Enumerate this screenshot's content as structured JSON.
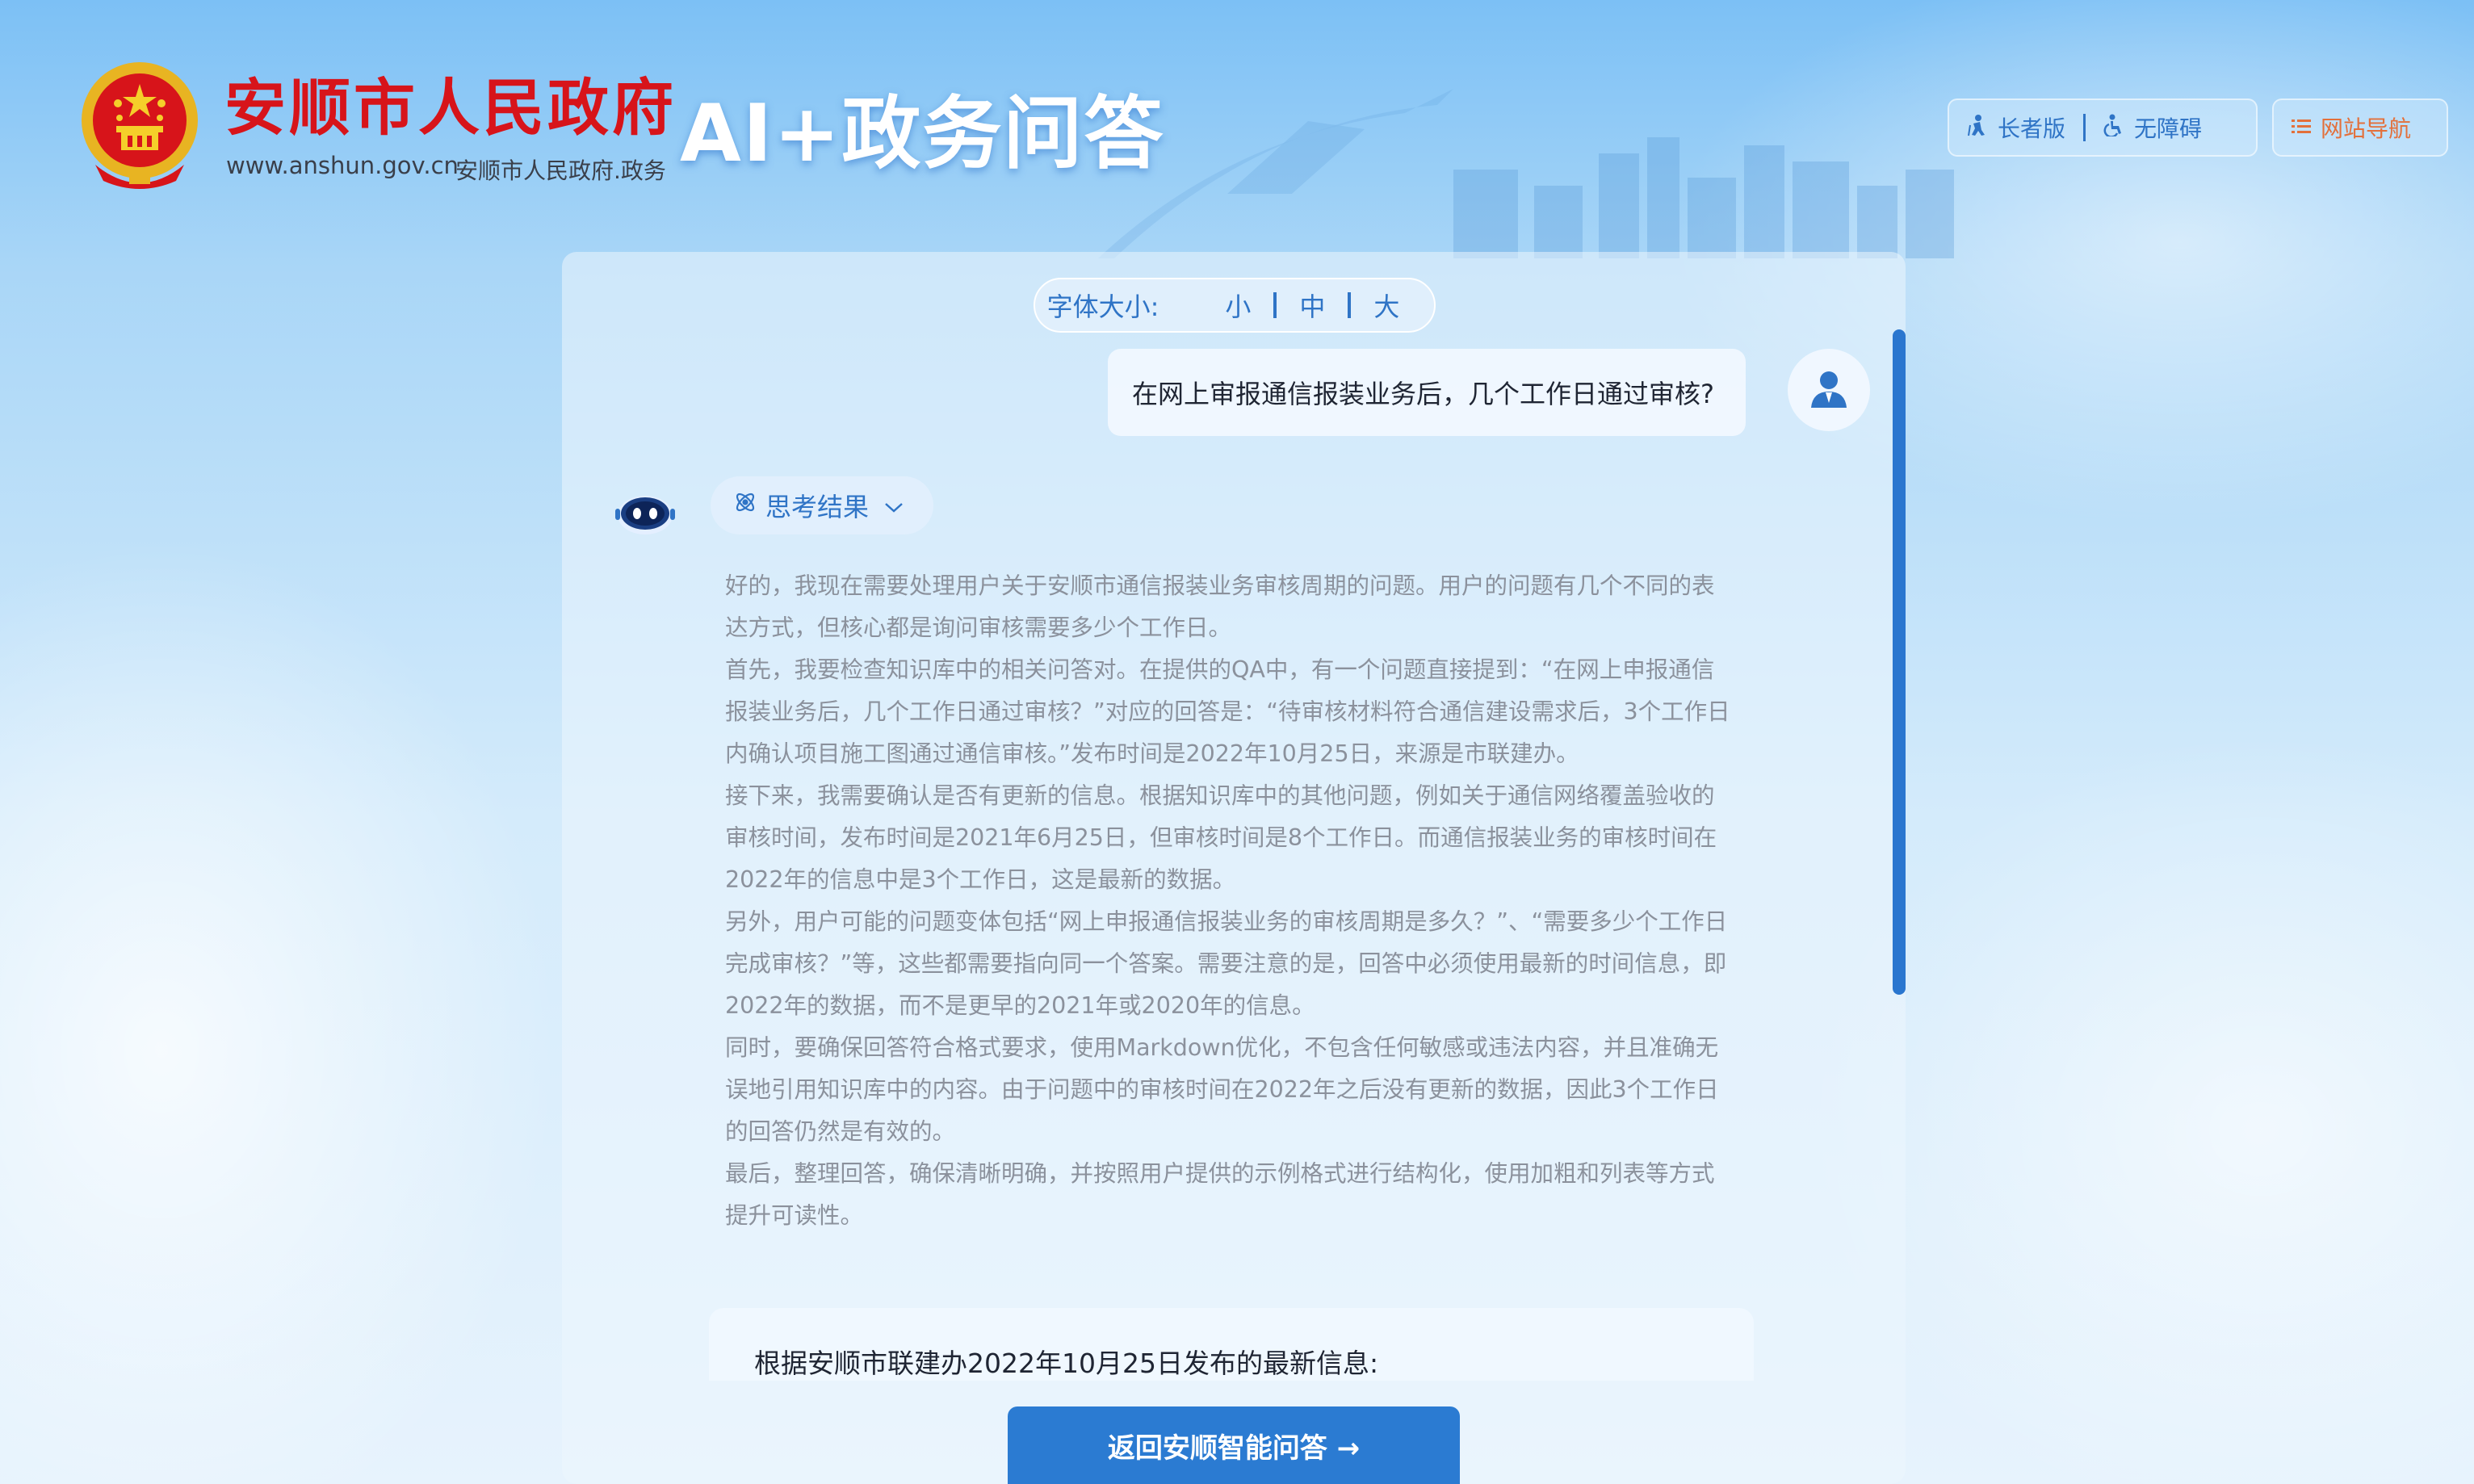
{
  "header": {
    "gov_name": "安顺市人民政府",
    "url": "www.anshun.gov.cn",
    "subtitle": "安顺市人民政府.政务",
    "ai_title": "AI+政务问答",
    "tools": {
      "elder": "长者版",
      "accessible": "无障碍",
      "site_nav": "网站导航"
    }
  },
  "font_size": {
    "label": "字体大小:",
    "small": "小",
    "medium": "中",
    "large": "大"
  },
  "chat": {
    "user_question": "在网上审报通信报装业务后，几个工作日通过审核?",
    "think_label": "思考结果",
    "thinking_paragraphs": [
      "好的，我现在需要处理用户关于安顺市通信报装业务审核周期的问题。用户的问题有几个不同的表达方式，但核心都是询问审核需要多少个工作日。",
      "首先，我要检查知识库中的相关问答对。在提供的QA中，有一个问题直接提到：“在网上申报通信报装业务后，几个工作日通过审核？”对应的回答是：“待审核材料符合通信建设需求后，3个工作日内确认项目施工图通过通信审核。”发布时间是2022年10月25日，来源是市联建办。",
      "接下来，我需要确认是否有更新的信息。根据知识库中的其他问题，例如关于通信网络覆盖验收的审核时间，发布时间是2021年6月25日，但审核时间是8个工作日。而通信报装业务的审核时间在2022年的信息中是3个工作日，这是最新的数据。",
      "另外，用户可能的问题变体包括“网上申报通信报装业务的审核周期是多久？”、“需要多少个工作日完成审核？”等，这些都需要指向同一个答案。需要注意的是，回答中必须使用最新的时间信息，即2022年的数据，而不是更早的2021年或2020年的信息。",
      "同时，要确保回答符合格式要求，使用Markdown优化，不包含任何敏感或违法内容，并且准确无误地引用知识库中的内容。由于问题中的审核时间在2022年之后没有更新的数据，因此3个工作日的回答仍然是有效的。",
      "最后，整理回答，确保清晰明确，并按照用户提供的示例格式进行结构化，使用加粗和列表等方式提升可读性。"
    ],
    "answer_intro": "根据安顺市联建办2022年10月25日发布的最新信息:"
  },
  "return_button": "返回安顺智能问答 →",
  "icons": {
    "emblem": "national-emblem",
    "elder": "elder-icon",
    "accessible": "wheelchair-icon",
    "nav": "list-icon",
    "user": "user-avatar-icon",
    "bot": "robot-icon",
    "think": "atom-icon",
    "chevron": "chevron-down-icon"
  },
  "colors": {
    "gov_red": "#d7141a",
    "primary_blue": "#2b7bd2",
    "nav_orange": "#e3703b",
    "thinking_gray": "#8b919c"
  }
}
